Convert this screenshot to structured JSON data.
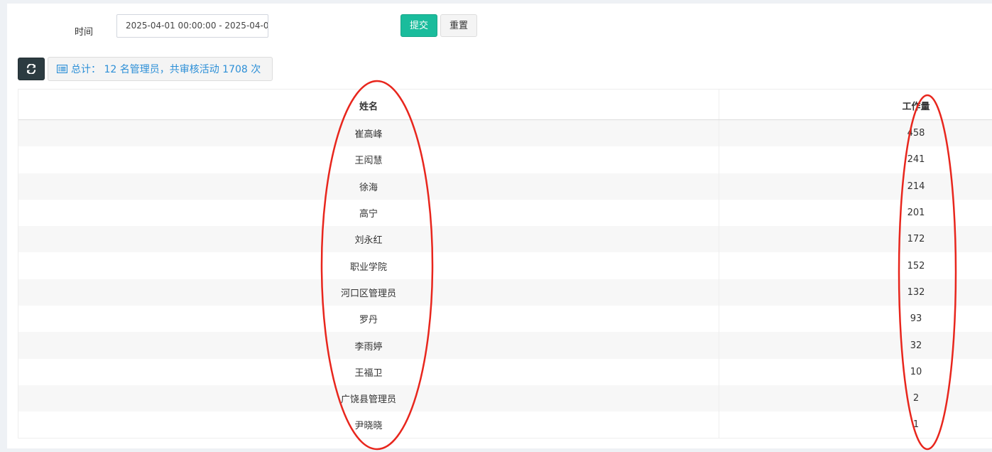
{
  "filter": {
    "time_label": "时间",
    "time_value": "2025-04-01 00:00:00 - 2025-04-0",
    "submit_label": "提交",
    "reset_label": "重置"
  },
  "toolbar": {
    "refresh_icon": "refresh-icon",
    "summary_icon": "list-icon",
    "summary_text": "总计： 12 名管理员，共审核活动 1708 次"
  },
  "table": {
    "headers": [
      "姓名",
      "工作量"
    ],
    "rows": [
      [
        "崔高峰",
        "458"
      ],
      [
        "王闳慧",
        "241"
      ],
      [
        "徐海",
        "214"
      ],
      [
        "高宁",
        "201"
      ],
      [
        "刘永红",
        "172"
      ],
      [
        "职业学院",
        "152"
      ],
      [
        "河口区管理员",
        "132"
      ],
      [
        "罗丹",
        "93"
      ],
      [
        "李雨婷",
        "32"
      ],
      [
        "王福卫",
        "10"
      ],
      [
        "广饶县管理员",
        "2"
      ],
      [
        "尹晓晓",
        "1"
      ]
    ]
  },
  "colors": {
    "accent": "#1abc9c",
    "dark_button": "#2c3b41",
    "summary_text": "#2c8fd7",
    "annotation": "#e8261d"
  }
}
